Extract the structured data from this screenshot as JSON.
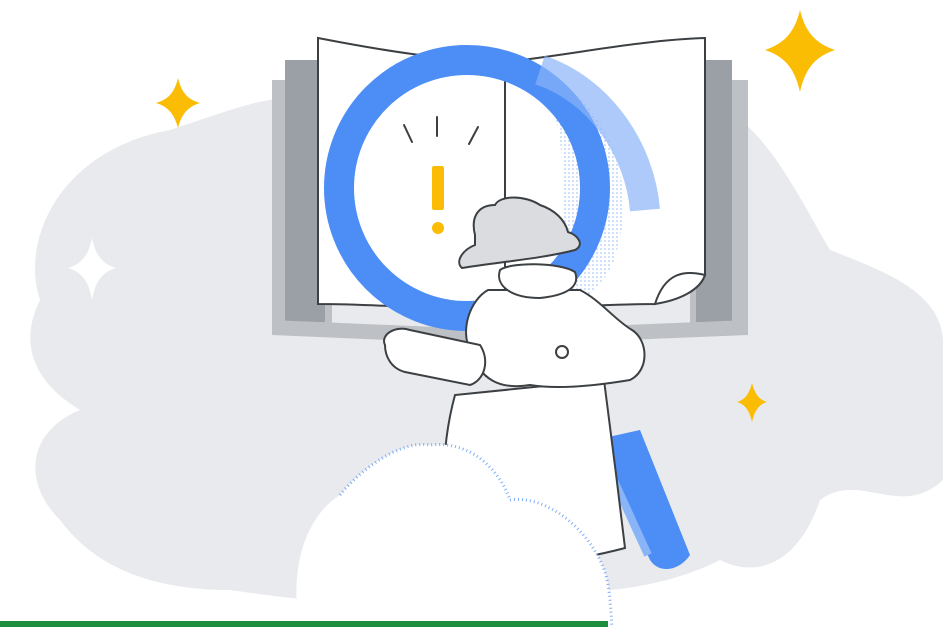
{
  "illustration": {
    "subject": "detective-with-magnifier-over-open-book",
    "icons": [
      "sparkle-icon",
      "exclamation-icon",
      "magnifier-icon",
      "detective-figure",
      "open-book",
      "cloud"
    ]
  },
  "colors": {
    "background_blob": "#e8eaed",
    "book_shadow": "#9aa0a6",
    "outline": "#3c4043",
    "magnifier_blue": "#4c8df6",
    "magnifier_light": "#8ab4f8",
    "accent_yellow": "#fbbc04",
    "progress_green": "#1e8e3e",
    "white": "#ffffff",
    "hat_gray": "#dadce0"
  },
  "progress": {
    "fraction": 0.645
  }
}
